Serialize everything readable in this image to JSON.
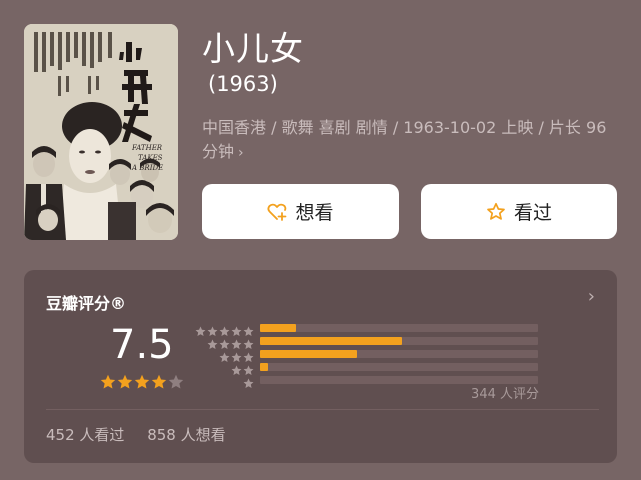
{
  "movie": {
    "title": "小儿女",
    "year": "(1963)",
    "meta": "中国香港 / 歌舞 喜剧 剧情 / 1963-10-02 上映 / 片长 96 分钟",
    "meta_chevron": "›",
    "poster_text": {
      "title_cn": "小兒女",
      "title_en": "FATHER TAKES A BRIDE"
    }
  },
  "actions": {
    "want_label": "想看",
    "want_icon": "heart-plus-icon",
    "seen_label": "看过",
    "seen_icon": "star-outline-icon"
  },
  "rating": {
    "title": "豆瓣评分®",
    "chevron": "›",
    "score": "7.5",
    "score_stars": 4,
    "votes": "344 人评分",
    "distribution": [
      {
        "stars": 5,
        "fraction": 0.13
      },
      {
        "stars": 4,
        "fraction": 0.51
      },
      {
        "stars": 3,
        "fraction": 0.35
      },
      {
        "stars": 2,
        "fraction": 0.03
      },
      {
        "stars": 1,
        "fraction": 0.0
      }
    ],
    "seen_count": "452 人看过",
    "want_count": "858 人想看"
  },
  "colors": {
    "background": "#776565",
    "card": "#604f50",
    "accent": "#f3a11e"
  }
}
